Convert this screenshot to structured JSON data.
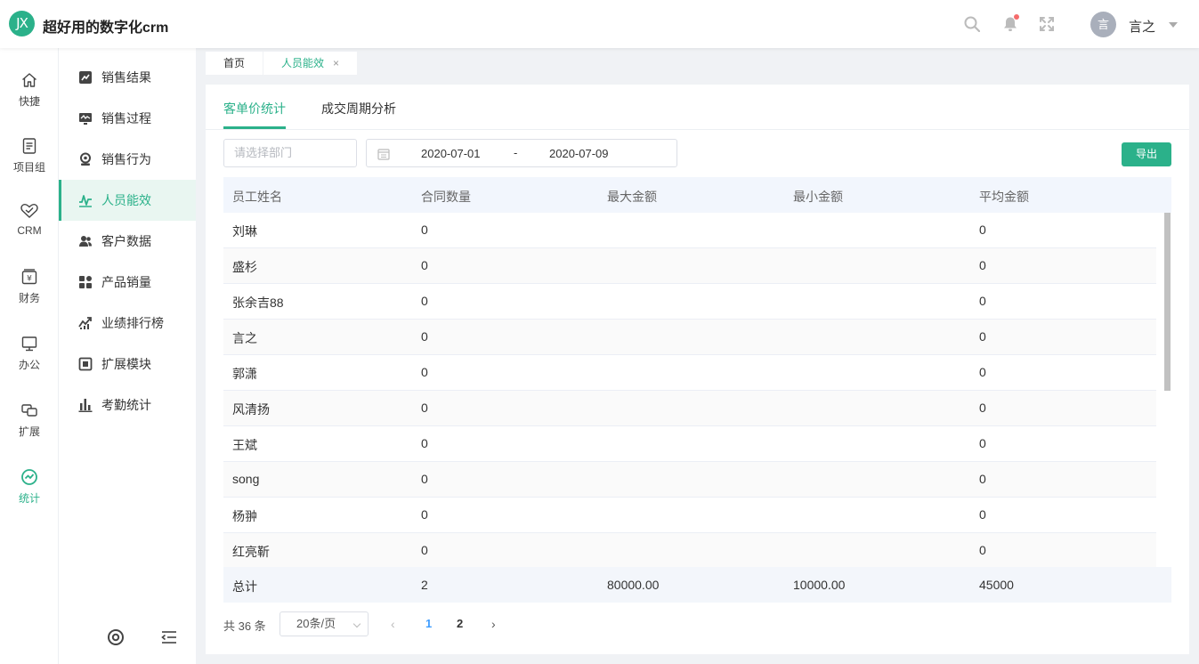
{
  "app": {
    "logo_text": "JX",
    "title": "超好用的数字化crm"
  },
  "header": {
    "icons": [
      "search-icon",
      "bell-icon",
      "fullscreen-icon"
    ],
    "user": {
      "avatar_text": "言",
      "name": "言之"
    }
  },
  "rail": {
    "items": [
      {
        "label": "快捷",
        "icon": "home-icon"
      },
      {
        "label": "项目组",
        "icon": "document-icon"
      },
      {
        "label": "CRM",
        "icon": "handshake-icon"
      },
      {
        "label": "财务",
        "icon": "finance-icon"
      },
      {
        "label": "办公",
        "icon": "monitor-icon"
      },
      {
        "label": "扩展",
        "icon": "extend-icon"
      },
      {
        "label": "统计",
        "icon": "stats-icon",
        "active": true
      }
    ]
  },
  "subnav": {
    "items": [
      {
        "label": "销售结果",
        "icon": "sales-result-icon"
      },
      {
        "label": "销售过程",
        "icon": "sales-process-icon"
      },
      {
        "label": "销售行为",
        "icon": "sales-behavior-icon"
      },
      {
        "label": "人员能效",
        "icon": "performance-icon",
        "active": true
      },
      {
        "label": "客户数据",
        "icon": "customers-icon"
      },
      {
        "label": "产品销量",
        "icon": "products-icon"
      },
      {
        "label": "业绩排行榜",
        "icon": "ranking-icon"
      },
      {
        "label": "扩展模块",
        "icon": "module-icon"
      },
      {
        "label": "考勤统计",
        "icon": "attendance-icon"
      }
    ],
    "bottom_icons": [
      "settings-icon",
      "collapse-menu-icon"
    ]
  },
  "page_tabs": [
    {
      "label": "首页"
    },
    {
      "label": "人员能效",
      "active": true,
      "close": "×"
    }
  ],
  "content": {
    "tabs": [
      {
        "label": "客单价统计",
        "active": true
      },
      {
        "label": "成交周期分析"
      }
    ],
    "filters": {
      "department_placeholder": "请选择部门",
      "date_start": "2020-07-01",
      "date_separator": "-",
      "date_end": "2020-07-09"
    },
    "export_label": "导出",
    "table": {
      "columns": [
        "员工姓名",
        "合同数量",
        "最大金额",
        "最小金额",
        "平均金额"
      ],
      "rows": [
        {
          "name": "刘琳",
          "contracts": "0",
          "max": "",
          "min": "",
          "avg": "0"
        },
        {
          "name": "盛杉",
          "contracts": "0",
          "max": "",
          "min": "",
          "avg": "0"
        },
        {
          "name": "张余吉88",
          "contracts": "0",
          "max": "",
          "min": "",
          "avg": "0"
        },
        {
          "name": "言之",
          "contracts": "0",
          "max": "",
          "min": "",
          "avg": "0"
        },
        {
          "name": "郭潇",
          "contracts": "0",
          "max": "",
          "min": "",
          "avg": "0"
        },
        {
          "name": "风清扬",
          "contracts": "0",
          "max": "",
          "min": "",
          "avg": "0"
        },
        {
          "name": "王斌",
          "contracts": "0",
          "max": "",
          "min": "",
          "avg": "0"
        },
        {
          "name": "song",
          "contracts": "0",
          "max": "",
          "min": "",
          "avg": "0"
        },
        {
          "name": "杨翀",
          "contracts": "0",
          "max": "",
          "min": "",
          "avg": "0"
        },
        {
          "name": "红亮靳",
          "contracts": "0",
          "max": "",
          "min": "",
          "avg": "0"
        }
      ],
      "total": {
        "name": "总计",
        "contracts": "2",
        "max": "80000.00",
        "min": "10000.00",
        "avg": "45000"
      }
    },
    "pagination": {
      "total_text": "共 36 条",
      "page_size": "20条/页",
      "prev": "‹",
      "next": "›",
      "pages": [
        "1",
        "2"
      ],
      "current": "1"
    }
  },
  "colors": {
    "accent": "#2bb18a",
    "page_active": "#409eff"
  }
}
